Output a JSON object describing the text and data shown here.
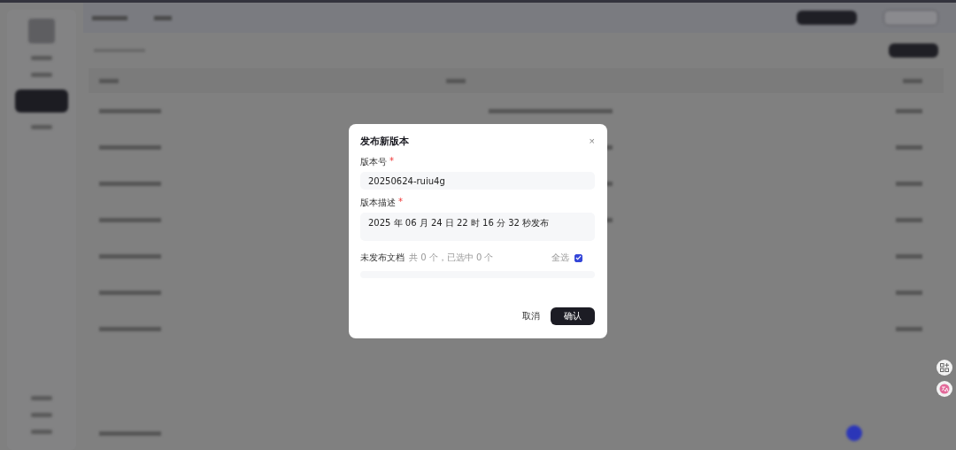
{
  "dialog": {
    "title": "发布新版本",
    "close": "×",
    "fields": [
      {
        "kind": "input",
        "label": "版本号",
        "required_mark": "*",
        "value": "20250624-ruiu4g"
      },
      {
        "kind": "textarea",
        "label": "版本描述",
        "required_mark": "*",
        "value": "2025 年 06 月 24 日 22 时 16 分 32 秒发布"
      }
    ],
    "documents": {
      "label": "未发布文档",
      "summary": "共 0 个，已选中 0 个",
      "select_all": {
        "label": "全选",
        "checked": true
      }
    },
    "buttons": [
      {
        "kind": "secondary",
        "label": "取消"
      },
      {
        "kind": "primary",
        "label": "确认"
      }
    ]
  }
}
